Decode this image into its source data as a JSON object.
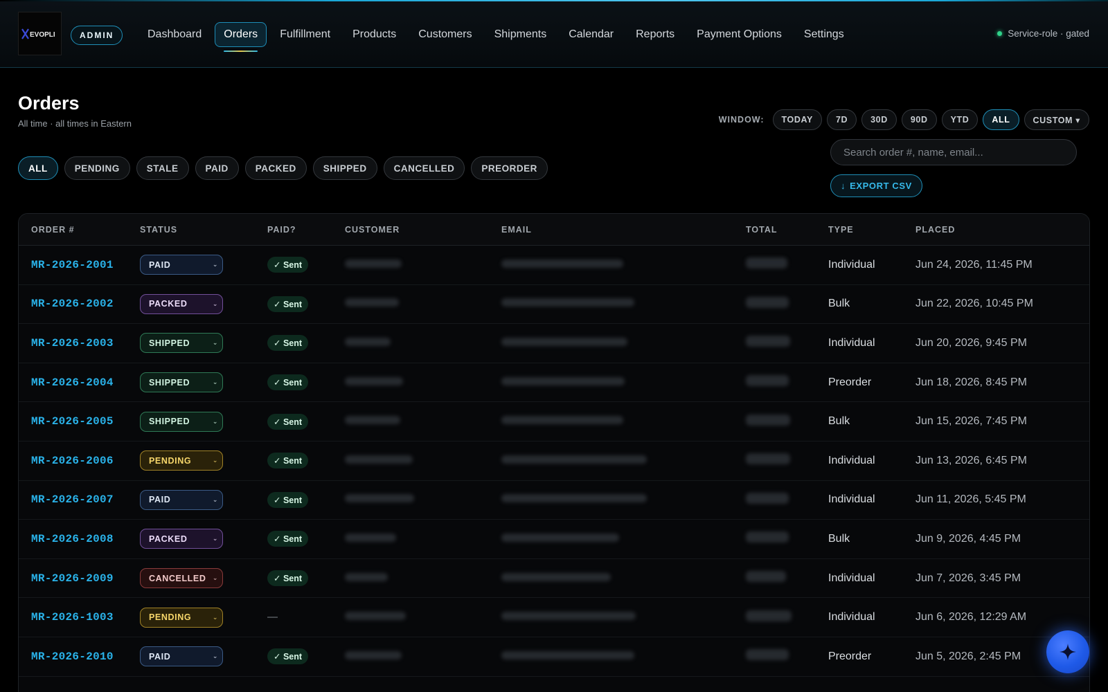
{
  "app": {
    "logo_text": "EVOPLI",
    "admin_badge": "ADMIN",
    "service_status": "Service-role · gated"
  },
  "nav": [
    {
      "label": "Dashboard",
      "active": false
    },
    {
      "label": "Orders",
      "active": true
    },
    {
      "label": "Fulfillment",
      "active": false
    },
    {
      "label": "Products",
      "active": false
    },
    {
      "label": "Customers",
      "active": false
    },
    {
      "label": "Shipments",
      "active": false
    },
    {
      "label": "Calendar",
      "active": false
    },
    {
      "label": "Reports",
      "active": false
    },
    {
      "label": "Payment Options",
      "active": false
    },
    {
      "label": "Settings",
      "active": false
    }
  ],
  "page": {
    "title": "Orders",
    "subtitle": "All time · all times in Eastern"
  },
  "window": {
    "label": "WINDOW:",
    "options": [
      "TODAY",
      "7D",
      "30D",
      "90D",
      "YTD",
      "ALL",
      "CUSTOM ▾"
    ],
    "selected": "ALL"
  },
  "search": {
    "placeholder": "Search order #, name, email...",
    "value": ""
  },
  "export": {
    "label": "EXPORT CSV",
    "icon": "↓"
  },
  "filters": {
    "options": [
      "ALL",
      "PENDING",
      "STALE",
      "PAID",
      "PACKED",
      "SHIPPED",
      "CANCELLED",
      "PREORDER"
    ],
    "selected": "ALL"
  },
  "table": {
    "headers": [
      "ORDER #",
      "STATUS",
      "PAID?",
      "CUSTOMER",
      "EMAIL",
      "TOTAL",
      "TYPE",
      "PLACED"
    ],
    "rows": [
      {
        "order": "MR-2026-2001",
        "status": "PAID",
        "paid": "✓ Sent",
        "type": "Individual",
        "placed": "Jun 24, 2026, 11:45 PM"
      },
      {
        "order": "MR-2026-2002",
        "status": "PACKED",
        "paid": "✓ Sent",
        "type": "Bulk",
        "placed": "Jun 22, 2026, 10:45 PM"
      },
      {
        "order": "MR-2026-2003",
        "status": "SHIPPED",
        "paid": "✓ Sent",
        "type": "Individual",
        "placed": "Jun 20, 2026, 9:45 PM"
      },
      {
        "order": "MR-2026-2004",
        "status": "SHIPPED",
        "paid": "✓ Sent",
        "type": "Preorder",
        "placed": "Jun 18, 2026, 8:45 PM"
      },
      {
        "order": "MR-2026-2005",
        "status": "SHIPPED",
        "paid": "✓ Sent",
        "type": "Bulk",
        "placed": "Jun 15, 2026, 7:45 PM"
      },
      {
        "order": "MR-2026-2006",
        "status": "PENDING",
        "paid": "✓ Sent",
        "type": "Individual",
        "placed": "Jun 13, 2026, 6:45 PM"
      },
      {
        "order": "MR-2026-2007",
        "status": "PAID",
        "paid": "✓ Sent",
        "type": "Individual",
        "placed": "Jun 11, 2026, 5:45 PM"
      },
      {
        "order": "MR-2026-2008",
        "status": "PACKED",
        "paid": "✓ Sent",
        "type": "Bulk",
        "placed": "Jun 9, 2026, 4:45 PM"
      },
      {
        "order": "MR-2026-2009",
        "status": "CANCELLED",
        "paid": "✓ Sent",
        "type": "Individual",
        "placed": "Jun 7, 2026, 3:45 PM"
      },
      {
        "order": "MR-2026-1003",
        "status": "PENDING",
        "paid": "—",
        "type": "Individual",
        "placed": "Jun 6, 2026, 12:29 AM"
      },
      {
        "order": "MR-2026-2010",
        "status": "PAID",
        "paid": "✓ Sent",
        "type": "Preorder",
        "placed": "Jun 5, 2026, 2:45 PM"
      }
    ]
  },
  "fab": {
    "icon": "sparkle-icon"
  },
  "colors": {
    "accent": "#2ab3ea",
    "background": "#000000",
    "paid": "#3b5b86",
    "packed": "#72509a",
    "shipped": "#2f7a56",
    "pending": "#a08227",
    "cancelled": "#8a3b3b"
  }
}
